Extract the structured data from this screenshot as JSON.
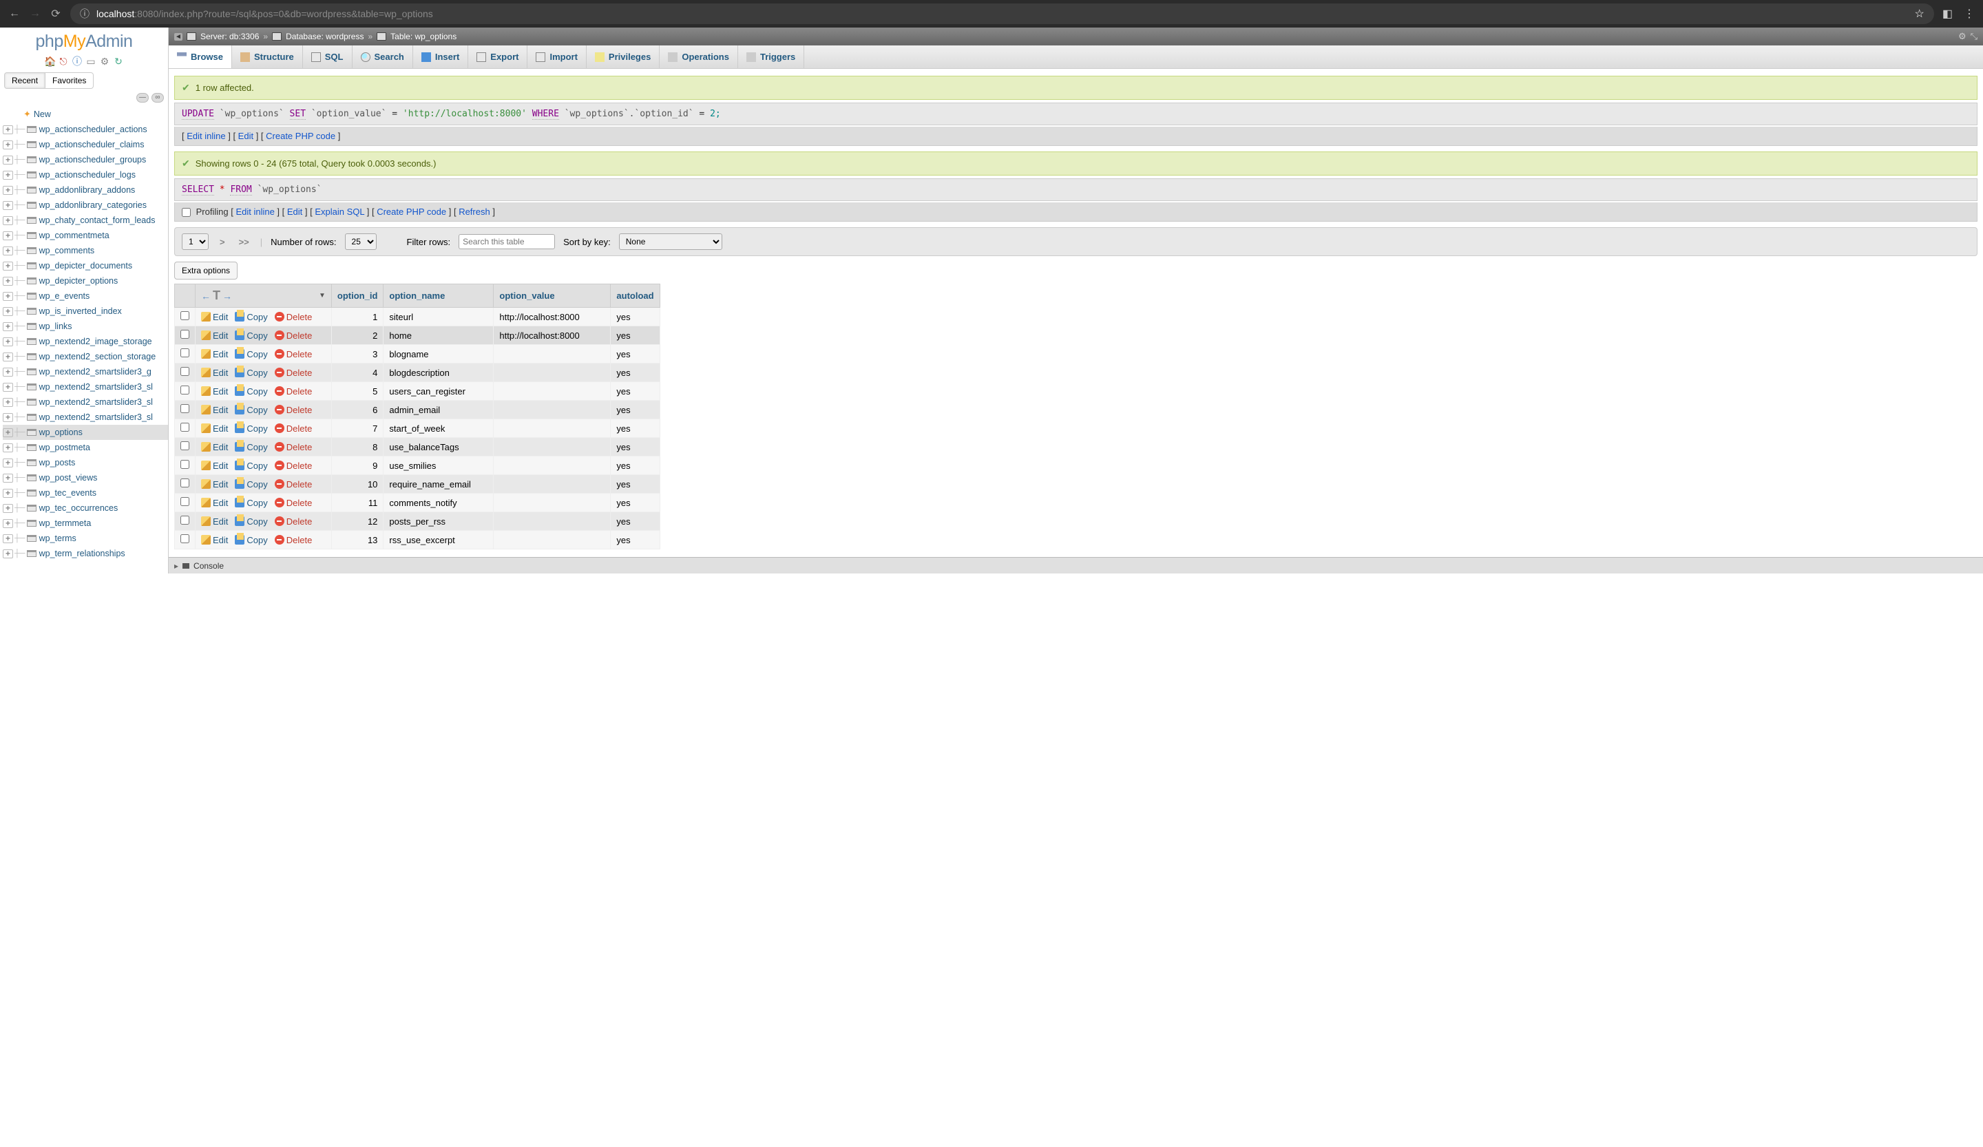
{
  "browser": {
    "url_host": "localhost",
    "url_path": ":8080/index.php?route=/sql&pos=0&db=wordpress&table=wp_options"
  },
  "logo": {
    "php": "php",
    "my": "My",
    "admin": "Admin"
  },
  "sidebar": {
    "tabs": {
      "recent": "Recent",
      "favorites": "Favorites"
    },
    "new_label": "New",
    "tables": [
      "wp_actionscheduler_actions",
      "wp_actionscheduler_claims",
      "wp_actionscheduler_groups",
      "wp_actionscheduler_logs",
      "wp_addonlibrary_addons",
      "wp_addonlibrary_categories",
      "wp_chaty_contact_form_leads",
      "wp_commentmeta",
      "wp_comments",
      "wp_depicter_documents",
      "wp_depicter_options",
      "wp_e_events",
      "wp_is_inverted_index",
      "wp_links",
      "wp_nextend2_image_storage",
      "wp_nextend2_section_storage",
      "wp_nextend2_smartslider3_g",
      "wp_nextend2_smartslider3_sl",
      "wp_nextend2_smartslider3_sl",
      "wp_nextend2_smartslider3_sl",
      "wp_options",
      "wp_postmeta",
      "wp_posts",
      "wp_post_views",
      "wp_tec_events",
      "wp_tec_occurrences",
      "wp_termmeta",
      "wp_terms",
      "wp_term_relationships"
    ],
    "selected": "wp_options"
  },
  "breadcrumb": {
    "server_label": "Server: db:3306",
    "db_label": "Database: wordpress",
    "table_label": "Table: wp_options"
  },
  "tabs": [
    {
      "label": "Browse",
      "icon": "browse"
    },
    {
      "label": "Structure",
      "icon": "struct"
    },
    {
      "label": "SQL",
      "icon": "sql"
    },
    {
      "label": "Search",
      "icon": "search"
    },
    {
      "label": "Insert",
      "icon": "insert"
    },
    {
      "label": "Export",
      "icon": "export"
    },
    {
      "label": "Import",
      "icon": "import"
    },
    {
      "label": "Privileges",
      "icon": "priv"
    },
    {
      "label": "Operations",
      "icon": "ops"
    },
    {
      "label": "Triggers",
      "icon": "trig"
    }
  ],
  "messages": {
    "affected": "1 row affected.",
    "showing": "Showing rows 0 - 24 (675 total, Query took 0.0003 seconds.)"
  },
  "sql_update": {
    "kw_update": "UPDATE",
    "tbl": "`wp_options`",
    "kw_set": "SET",
    "col": "`option_value`",
    "eq": "=",
    "val": "'http://localhost:8000'",
    "kw_where": "WHERE",
    "whcol": "`wp_options`.`option_id`",
    "wheq": "=",
    "whval": "2;"
  },
  "sql_select": {
    "kw_select": "SELECT",
    "star": "*",
    "kw_from": "FROM",
    "tbl": "`wp_options`"
  },
  "actions1": {
    "edit_inline": "Edit inline",
    "edit": "Edit",
    "create_php": "Create PHP code"
  },
  "actions2": {
    "profiling": "Profiling",
    "edit_inline": "Edit inline",
    "edit": "Edit",
    "explain": "Explain SQL",
    "create_php": "Create PHP code",
    "refresh": "Refresh"
  },
  "controls": {
    "page": "1",
    "gt": ">",
    "gtgt": ">>",
    "num_rows_label": "Number of rows:",
    "rows_value": "25",
    "filter_label": "Filter rows:",
    "filter_placeholder": "Search this table",
    "sort_label": "Sort by key:",
    "sort_value": "None"
  },
  "extra_btn": "Extra options",
  "table": {
    "headers": {
      "option_id": "option_id",
      "option_name": "option_name",
      "option_value": "option_value",
      "autoload": "autoload"
    },
    "row_actions": {
      "edit": "Edit",
      "copy": "Copy",
      "delete": "Delete"
    },
    "rows": [
      {
        "id": "1",
        "name": "siteurl",
        "value": "http://localhost:8000",
        "autoload": "yes",
        "redact": false
      },
      {
        "id": "2",
        "name": "home",
        "value": "http://localhost:8000",
        "autoload": "yes",
        "redact": false,
        "highlight": true
      },
      {
        "id": "3",
        "name": "blogname",
        "value": "",
        "autoload": "yes",
        "redact": true
      },
      {
        "id": "4",
        "name": "blogdescription",
        "value": "",
        "autoload": "yes",
        "redact": true
      },
      {
        "id": "5",
        "name": "users_can_register",
        "value": "",
        "autoload": "yes",
        "redact": true
      },
      {
        "id": "6",
        "name": "admin_email",
        "value": "",
        "autoload": "yes",
        "redact": true
      },
      {
        "id": "7",
        "name": "start_of_week",
        "value": "",
        "autoload": "yes",
        "redact": true
      },
      {
        "id": "8",
        "name": "use_balanceTags",
        "value": "",
        "autoload": "yes",
        "redact": true
      },
      {
        "id": "9",
        "name": "use_smilies",
        "value": "",
        "autoload": "yes",
        "redact": true
      },
      {
        "id": "10",
        "name": "require_name_email",
        "value": "",
        "autoload": "yes",
        "redact": true
      },
      {
        "id": "11",
        "name": "comments_notify",
        "value": "",
        "autoload": "yes",
        "redact": true
      },
      {
        "id": "12",
        "name": "posts_per_rss",
        "value": "",
        "autoload": "yes",
        "redact": true
      },
      {
        "id": "13",
        "name": "rss_use_excerpt",
        "value": "",
        "autoload": "yes",
        "redact": true
      }
    ]
  },
  "console_label": "Console"
}
